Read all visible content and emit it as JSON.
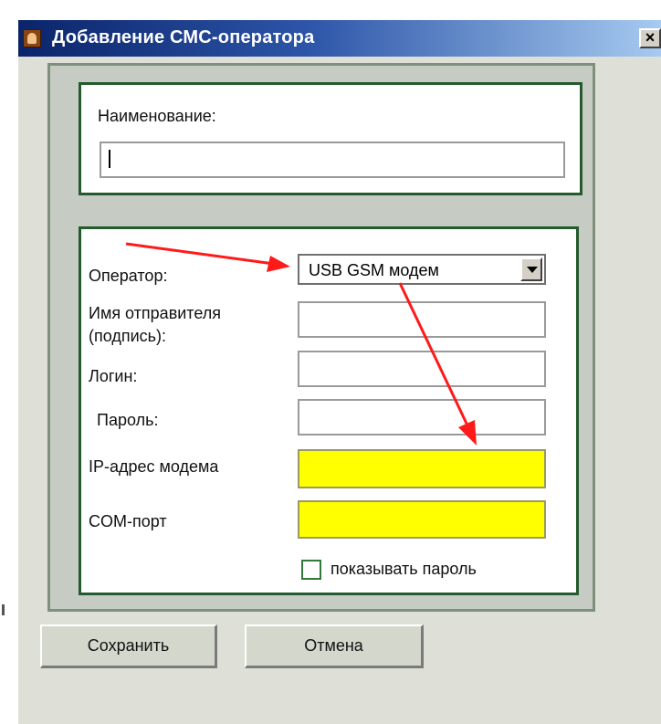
{
  "window": {
    "title": "Добавление СМС-оператора",
    "close_glyph": "×",
    "icon": "app-icon"
  },
  "name_section": {
    "label": "Наименование:",
    "value": ""
  },
  "settings": {
    "operator_label": "Оператор:",
    "operator_selected": "USB GSM модем",
    "sender_label_line1": "Имя отправителя",
    "sender_label_line2": "(подпись):",
    "sender_value": "",
    "login_label": "Логин:",
    "login_value": "",
    "password_label": "Пароль:",
    "password_value": "",
    "modem_ip_label": "IP-адрес модема",
    "modem_ip_value": "",
    "com_port_label": "COM-порт",
    "com_port_value": "",
    "show_password_label": "показывать пароль",
    "show_password_checked": false
  },
  "buttons": {
    "save_label": "Сохранить",
    "cancel_label": "Отмена"
  },
  "colors": {
    "highlight_field": "#ffff00",
    "annotation_arrow": "#ff1a1a",
    "group_border": "#245a2d",
    "title_bar": "#0a246a"
  }
}
